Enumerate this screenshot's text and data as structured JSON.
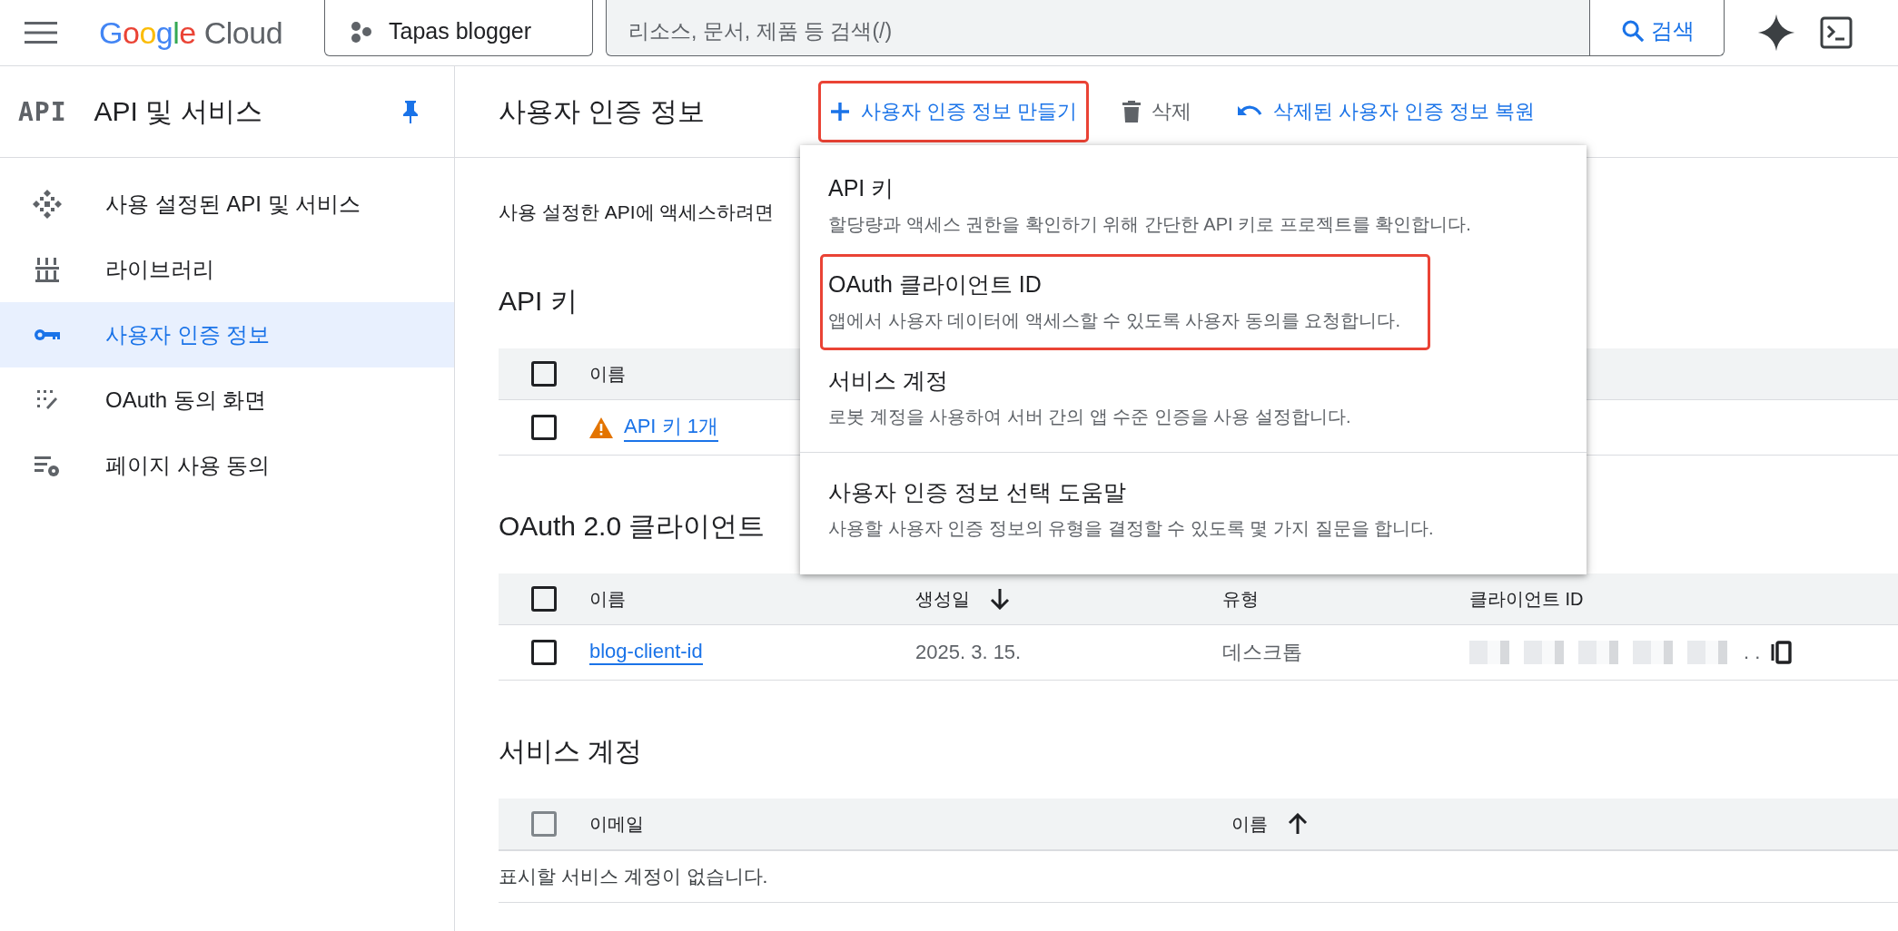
{
  "topbar": {
    "logo": "Google Cloud",
    "project": "Tapas blogger",
    "search": {
      "placeholder": "리소스, 문서, 제품 등 검색(/)",
      "button": "검색"
    }
  },
  "sidebar": {
    "badge": "API",
    "title": "API 및 서비스",
    "pinned": true,
    "items": [
      {
        "label": "사용 설정된 API 및 서비스",
        "selected": false
      },
      {
        "label": "라이브러리",
        "selected": false
      },
      {
        "label": "사용자 인증 정보",
        "selected": true
      },
      {
        "label": "OAuth 동의 화면",
        "selected": false
      },
      {
        "label": "페이지 사용 동의",
        "selected": false
      }
    ]
  },
  "header": {
    "title": "사용자 인증 정보",
    "actions": [
      {
        "kind": "create",
        "label": "사용자 인증 정보 만들기",
        "highlighted": true
      },
      {
        "kind": "delete",
        "label": "삭제",
        "highlighted": false
      },
      {
        "kind": "restore",
        "label": "삭제된 사용자 인증 정보 복원",
        "highlighted": false
      }
    ]
  },
  "intro": "사용 설정한 API에 액세스하려면",
  "menu": [
    {
      "title": "API 키",
      "description": "할당량과 액세스 권한을 확인하기 위해 간단한 API 키로 프로젝트를 확인합니다.",
      "highlighted": false,
      "divider_before": false
    },
    {
      "title": "OAuth 클라이언트 ID",
      "description": "앱에서 사용자 데이터에 액세스할 수 있도록 사용자 동의를 요청합니다.",
      "highlighted": true,
      "divider_before": false
    },
    {
      "title": "서비스 계정",
      "description": "로봇 계정을 사용하여 서버 간의 앱 수준 인증을 사용 설정합니다.",
      "highlighted": false,
      "divider_before": false
    },
    {
      "title": "사용자 인증 정보 선택 도움말",
      "description": "사용할 사용자 인증 정보의 유형을 결정할 수 있도록 몇 가지 질문을 합니다.",
      "highlighted": false,
      "divider_before": true
    }
  ],
  "sections": [
    {
      "title": "API 키",
      "columns": [
        {
          "label": "이름",
          "kind": "plain"
        }
      ],
      "header_checkbox_disabled": false,
      "rows": [
        {
          "kind": "api-key",
          "checked": false,
          "cells": [
            "API 키 1개"
          ],
          "warning": true
        }
      ]
    },
    {
      "title": "OAuth 2.0 클라이언트",
      "columns": [
        {
          "label": "이름",
          "kind": "plain"
        },
        {
          "label": "생성일",
          "kind": "sort-desc"
        },
        {
          "label": "유형",
          "kind": "plain"
        },
        {
          "label": "클라이언트 ID",
          "kind": "plain"
        }
      ],
      "header_checkbox_disabled": false,
      "rows": [
        {
          "kind": "client",
          "checked": false,
          "cells": [
            "blog-client-id",
            "2025. 3. 15.",
            "데스크톱",
            ". ."
          ]
        }
      ]
    },
    {
      "title": "서비스 계정",
      "columns": [
        {
          "label": "이메일",
          "kind": "plain"
        },
        {
          "label": "이름",
          "kind": "sort-asc"
        }
      ],
      "header_checkbox_disabled": true,
      "empty": "표시할 서비스 계정이 없습니다."
    }
  ]
}
